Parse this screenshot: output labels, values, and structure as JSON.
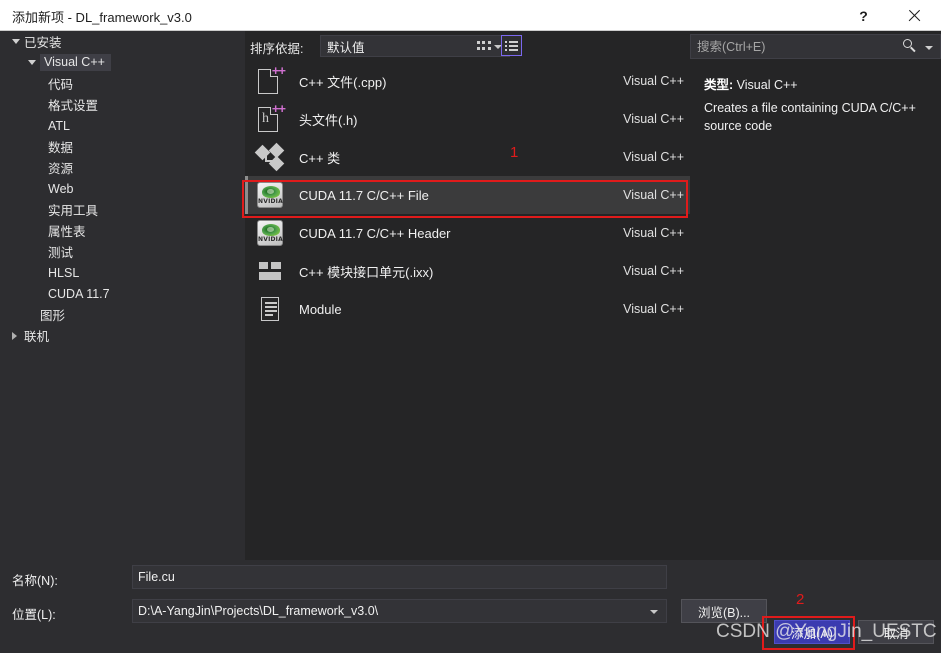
{
  "window": {
    "title": "添加新项 - DL_framework_v3.0",
    "help_glyph": "?",
    "close_glyph": "×"
  },
  "sidebar": {
    "items": [
      {
        "label": "已安装",
        "level": 0,
        "arrow": "down",
        "selected": false
      },
      {
        "label": "Visual C++",
        "level": 1,
        "arrow": "down",
        "selected": true
      },
      {
        "label": "代码",
        "level": 2,
        "arrow": "none",
        "selected": false
      },
      {
        "label": "格式设置",
        "level": 2,
        "arrow": "none",
        "selected": false
      },
      {
        "label": "ATL",
        "level": 2,
        "arrow": "none",
        "selected": false
      },
      {
        "label": "数据",
        "level": 2,
        "arrow": "none",
        "selected": false
      },
      {
        "label": "资源",
        "level": 2,
        "arrow": "none",
        "selected": false
      },
      {
        "label": "Web",
        "level": 2,
        "arrow": "none",
        "selected": false
      },
      {
        "label": "实用工具",
        "level": 2,
        "arrow": "none",
        "selected": false
      },
      {
        "label": "属性表",
        "level": 2,
        "arrow": "none",
        "selected": false
      },
      {
        "label": "测试",
        "level": 2,
        "arrow": "none",
        "selected": false
      },
      {
        "label": "HLSL",
        "level": 2,
        "arrow": "none",
        "selected": false
      },
      {
        "label": "CUDA 11.7",
        "level": 2,
        "arrow": "none",
        "selected": false
      },
      {
        "label": "图形",
        "level": 1,
        "arrow": "none",
        "selected": false
      },
      {
        "label": "联机",
        "level": 0,
        "arrow": "right",
        "selected": false
      }
    ]
  },
  "toolbar": {
    "sort_label": "排序依据:",
    "sort_value": "默认值",
    "grid_view_icon": "grid-view-icon",
    "list_view_icon": "list-view-icon",
    "list_view_selected": true
  },
  "item_list": {
    "items": [
      {
        "name": "C++ 文件(.cpp)",
        "lang": "Visual C++",
        "icon": "cpp-file-icon",
        "selected": false
      },
      {
        "name": "头文件(.h)",
        "lang": "Visual C++",
        "icon": "header-file-icon",
        "selected": false
      },
      {
        "name": "C++ 类",
        "lang": "Visual C++",
        "icon": "cpp-class-icon",
        "selected": false
      },
      {
        "name": "CUDA 11.7 C/C++ File",
        "lang": "Visual C++",
        "icon": "nvidia-cuda-icon",
        "selected": true
      },
      {
        "name": "CUDA 11.7 C/C++ Header",
        "lang": "Visual C++",
        "icon": "nvidia-cuda-icon",
        "selected": false
      },
      {
        "name": "C++ 模块接口单元(.ixx)",
        "lang": "Visual C++",
        "icon": "module-blocks-icon",
        "selected": false
      },
      {
        "name": "Module",
        "lang": "Visual C++",
        "icon": "module-page-icon",
        "selected": false
      }
    ]
  },
  "search": {
    "placeholder": "搜索(Ctrl+E)",
    "value": "",
    "icon": "search-icon"
  },
  "details": {
    "type_label": "类型:",
    "type_value": "Visual C++",
    "description": "Creates a file containing CUDA C/C++ source code"
  },
  "bottom": {
    "name_label": "名称(N):",
    "name_value": "File.cu",
    "location_label": "位置(L):",
    "location_value": "D:\\A-YangJin\\Projects\\DL_framework_v3.0\\",
    "browse_button": "浏览(B)...",
    "add_button": "添加(A)",
    "cancel_button": "取消"
  },
  "annotations": {
    "marker_1": "1",
    "marker_2": "2",
    "color": "#e01b1b"
  },
  "watermark": {
    "text": "CSDN @YangJin_UESTC"
  }
}
